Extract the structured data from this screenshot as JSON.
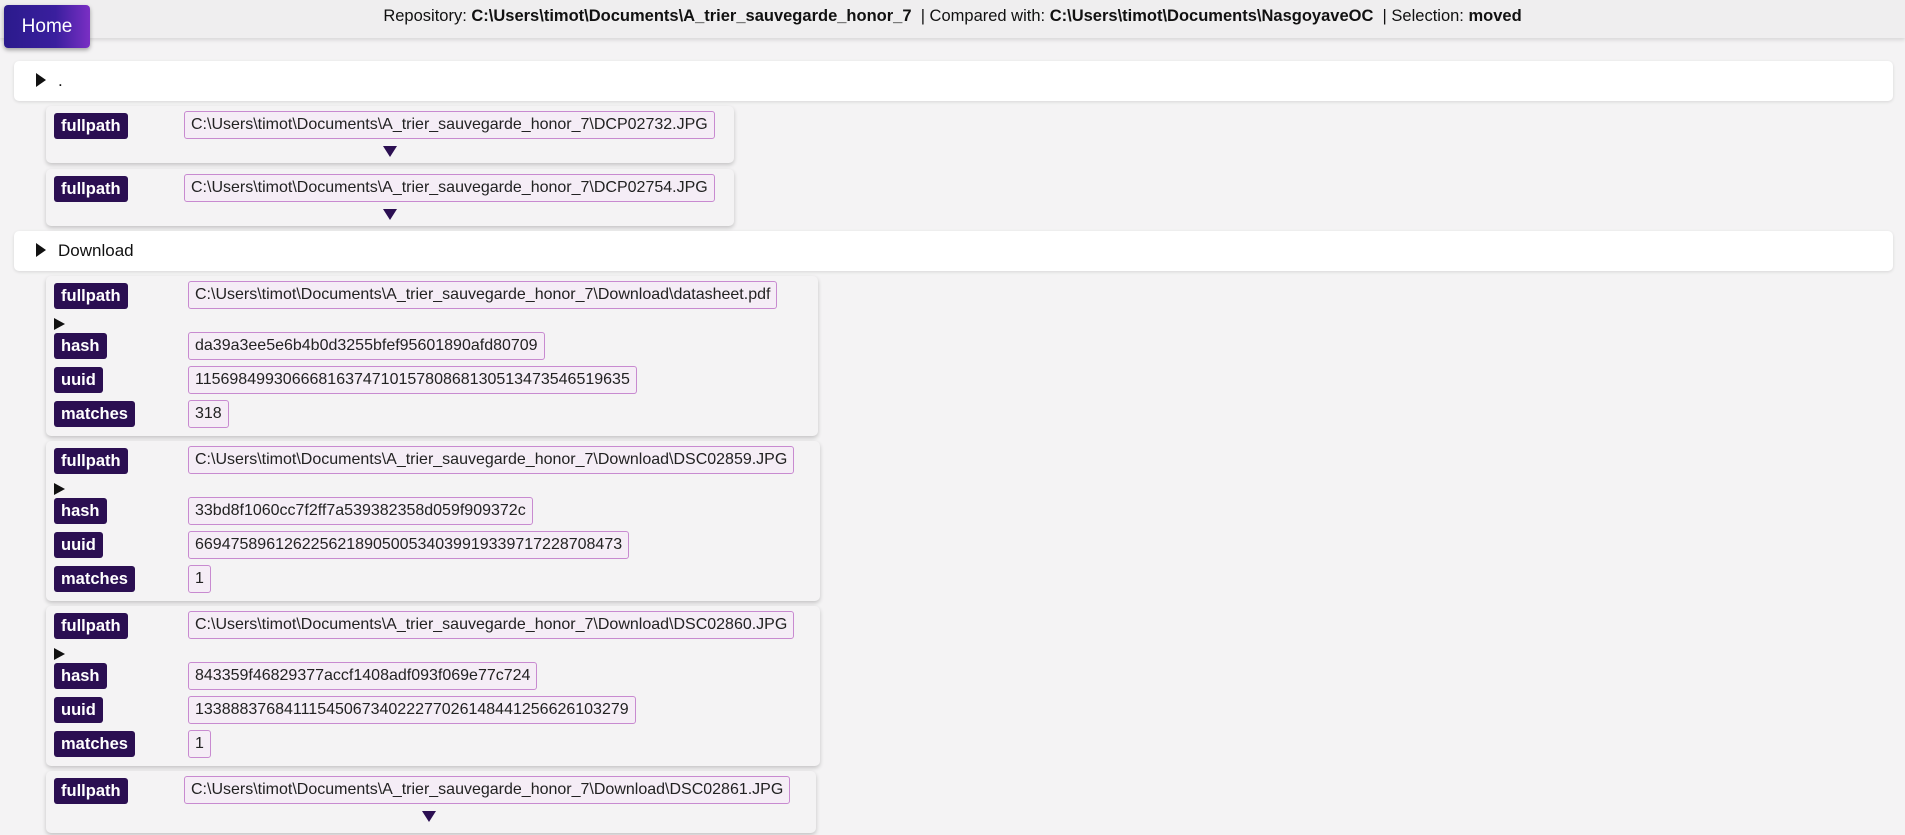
{
  "header": {
    "home_label": "Home",
    "repository_label": "Repository:",
    "repository_value": "C:\\Users\\timot\\Documents\\A_trier_sauvegarde_honor_7",
    "compared_label": "| Compared with:",
    "compared_value": "C:\\Users\\timot\\Documents\\NasgoyaveOC",
    "selection_label": "| Selection:",
    "selection_value": "moved"
  },
  "folders": [
    {
      "name": "."
    },
    {
      "name": "Download"
    }
  ],
  "root_files": [
    {
      "fullpath_label": "fullpath",
      "fullpath": "C:\\Users\\timot\\Documents\\A_trier_sauvegarde_honor_7\\DCP02732.JPG"
    },
    {
      "fullpath_label": "fullpath",
      "fullpath": "C:\\Users\\timot\\Documents\\A_trier_sauvegarde_honor_7\\DCP02754.JPG"
    }
  ],
  "download_files": [
    {
      "fullpath_label": "fullpath",
      "fullpath": "C:\\Users\\timot\\Documents\\A_trier_sauvegarde_honor_7\\Download\\datasheet.pdf",
      "hash_label": "hash",
      "hash": "da39a3ee5e6b4b0d3255bfef95601890afd80709",
      "uuid_label": "uuid",
      "uuid": "115698499306668163747101578086813051347354651963 5",
      "matches_label": "matches",
      "matches": "318"
    },
    {
      "fullpath_label": "fullpath",
      "fullpath": "C:\\Users\\timot\\Documents\\A_trier_sauvegarde_honor_7\\Download\\DSC02859.JPG",
      "hash_label": "hash",
      "hash": "33bd8f1060cc7f2ff7a539382358d059f909372c",
      "uuid_label": "uuid",
      "uuid": "66947589612622562189050053403991933971722870847 3",
      "matches_label": "matches",
      "matches": "1"
    },
    {
      "fullpath_label": "fullpath",
      "fullpath": "C:\\Users\\timot\\Documents\\A_trier_sauvegarde_honor_7\\Download\\DSC02860.JPG",
      "hash_label": "hash",
      "hash": "843359f46829377accf1408adf093f069e77c724",
      "uuid_label": "uuid",
      "uuid": "13388837684111545067340222770261484412566261032 79",
      "matches_label": "matches",
      "matches": "1"
    },
    {
      "fullpath_label": "fullpath",
      "fullpath": "C:\\Users\\timot\\Documents\\A_trier_sauvegarde_honor_7\\Download\\DSC02861.JPG"
    }
  ]
}
